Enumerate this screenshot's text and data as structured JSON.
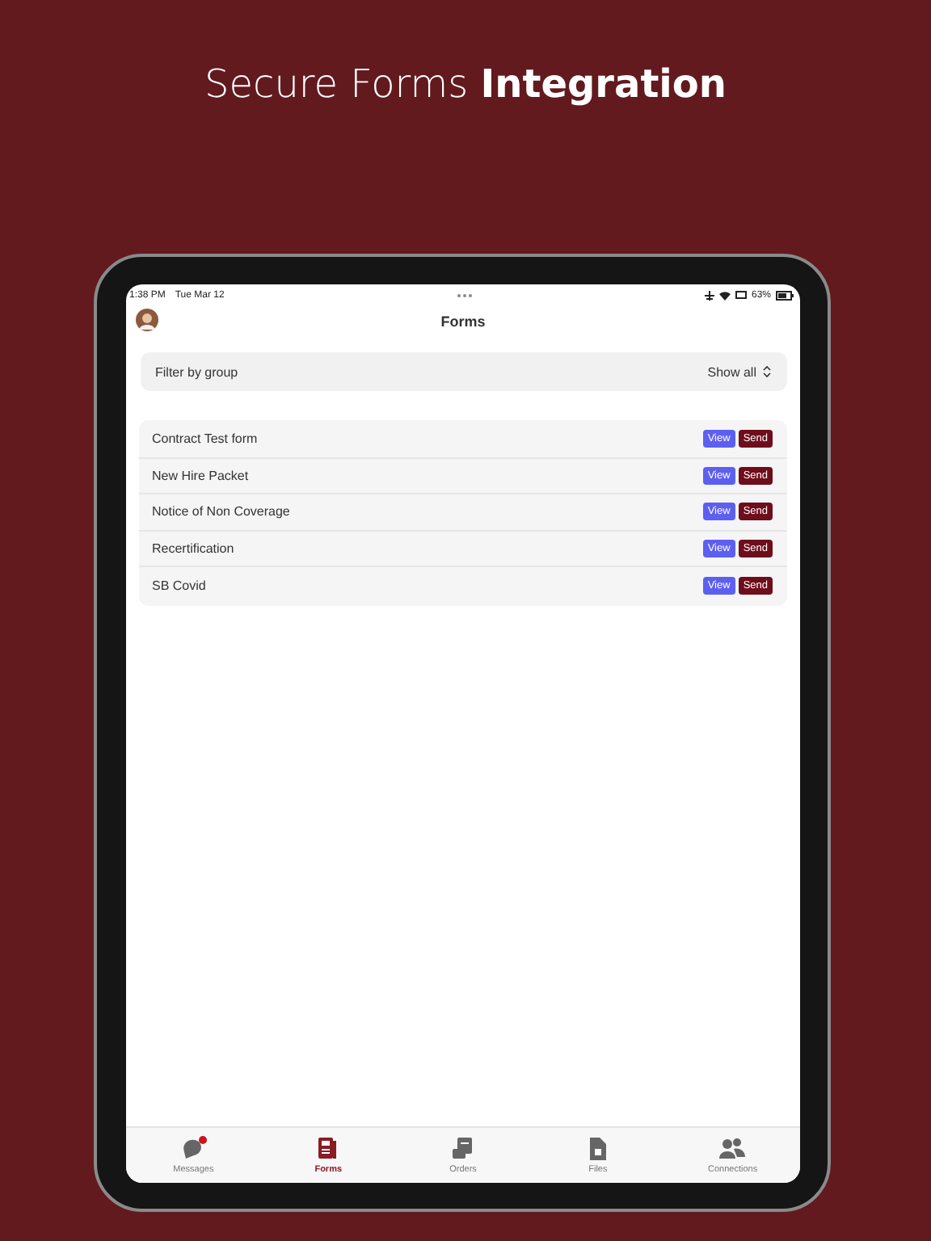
{
  "headline": "Secure Forms **Integration**",
  "status_bar": {
    "time": "1:38 PM",
    "date": "Tue Mar 12",
    "battery": "63%"
  },
  "header": {
    "title": "Forms"
  },
  "filter": {
    "label": "Filter by group",
    "value": "Show all"
  },
  "forms": [
    {
      "name": "Contract Test form",
      "actions": [
        "View",
        "Send"
      ]
    },
    {
      "name": "New Hire Packet",
      "actions": [
        "View",
        "Send"
      ]
    },
    {
      "name": "Notice of Non Coverage",
      "actions": [
        "View",
        "Send"
      ]
    },
    {
      "name": "Recertification",
      "actions": [
        "View",
        "Send"
      ]
    },
    {
      "name": "SB Covid",
      "actions": [
        "View",
        "Send"
      ]
    }
  ],
  "tab_bar": [
    {
      "label": "Messages",
      "selected": false,
      "badge": true
    },
    {
      "label": "Forms",
      "selected": true,
      "badge": false
    },
    {
      "label": "Orders",
      "selected": false,
      "badge": false
    },
    {
      "label": "Files",
      "selected": false,
      "badge": false
    },
    {
      "label": "Connections",
      "selected": false,
      "badge": false
    }
  ]
}
